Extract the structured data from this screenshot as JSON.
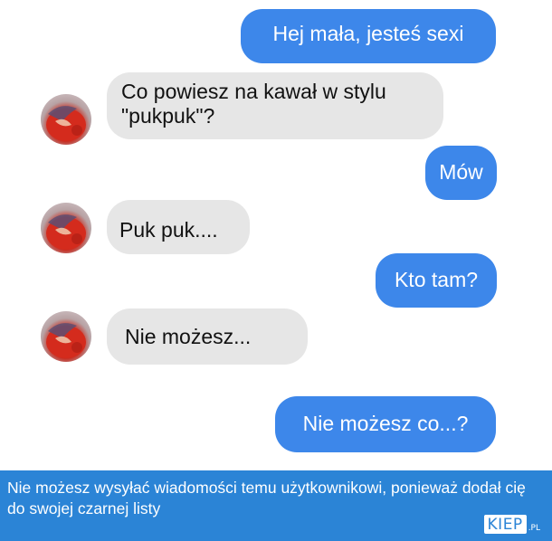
{
  "conversation": {
    "messages": [
      {
        "from": "me",
        "text": "Hej mała, jesteś sexi"
      },
      {
        "from": "them",
        "text": "Co powiesz na kawał w stylu\n\"pukpuk\"?"
      },
      {
        "from": "me",
        "text": "Mów"
      },
      {
        "from": "them",
        "text": "Puk puk...."
      },
      {
        "from": "me",
        "text": "Kto tam?"
      },
      {
        "from": "them",
        "text": "Nie możesz..."
      },
      {
        "from": "me",
        "text": "Nie możesz co...?"
      }
    ]
  },
  "banner": {
    "text": "Nie możesz wysyłać wiadomości temu użytkownikowi, ponieważ dodał cię do swojej czarnej listy",
    "logo": "KIEP",
    "logo_suffix": ".PL"
  },
  "colors": {
    "outgoing_bubble": "#3d87ea",
    "incoming_bubble": "#e6e6e6",
    "banner": "#2b84d6"
  }
}
